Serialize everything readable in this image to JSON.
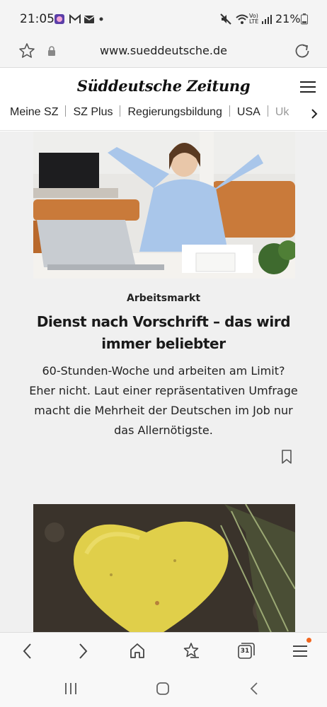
{
  "status_bar": {
    "time": "21:05",
    "network": "Vo) LTE",
    "battery": "21%"
  },
  "browser": {
    "url": "www.sueddeutsche.de"
  },
  "site": {
    "logo": "Süddeutsche Zeitung",
    "nav_items": [
      "Meine SZ",
      "SZ Plus",
      "Regierungsbildung",
      "USA",
      "Uk"
    ]
  },
  "article": {
    "kicker": "Arbeitsmarkt",
    "headline": "Dienst nach Vorschrift – das wird immer beliebter",
    "teaser": "60-Stunden-Woche und arbeiten am Limit? Eher nicht. Laut einer repräsentativen Umfrage macht die Mehrheit der Deutschen im Job nur das Allernötigste."
  },
  "toolbar": {
    "tabs_count": "31",
    "badge_color": "#f2661f"
  },
  "icons": [
    "star-icon",
    "lock-icon",
    "reload-icon",
    "hamburger-icon",
    "chevron-right-icon",
    "bookmark-icon",
    "back-icon",
    "forward-icon",
    "home-icon",
    "bookmarks-icon",
    "tabs-icon",
    "menu-icon",
    "recents-icon",
    "home-button-icon",
    "back-button-icon"
  ]
}
